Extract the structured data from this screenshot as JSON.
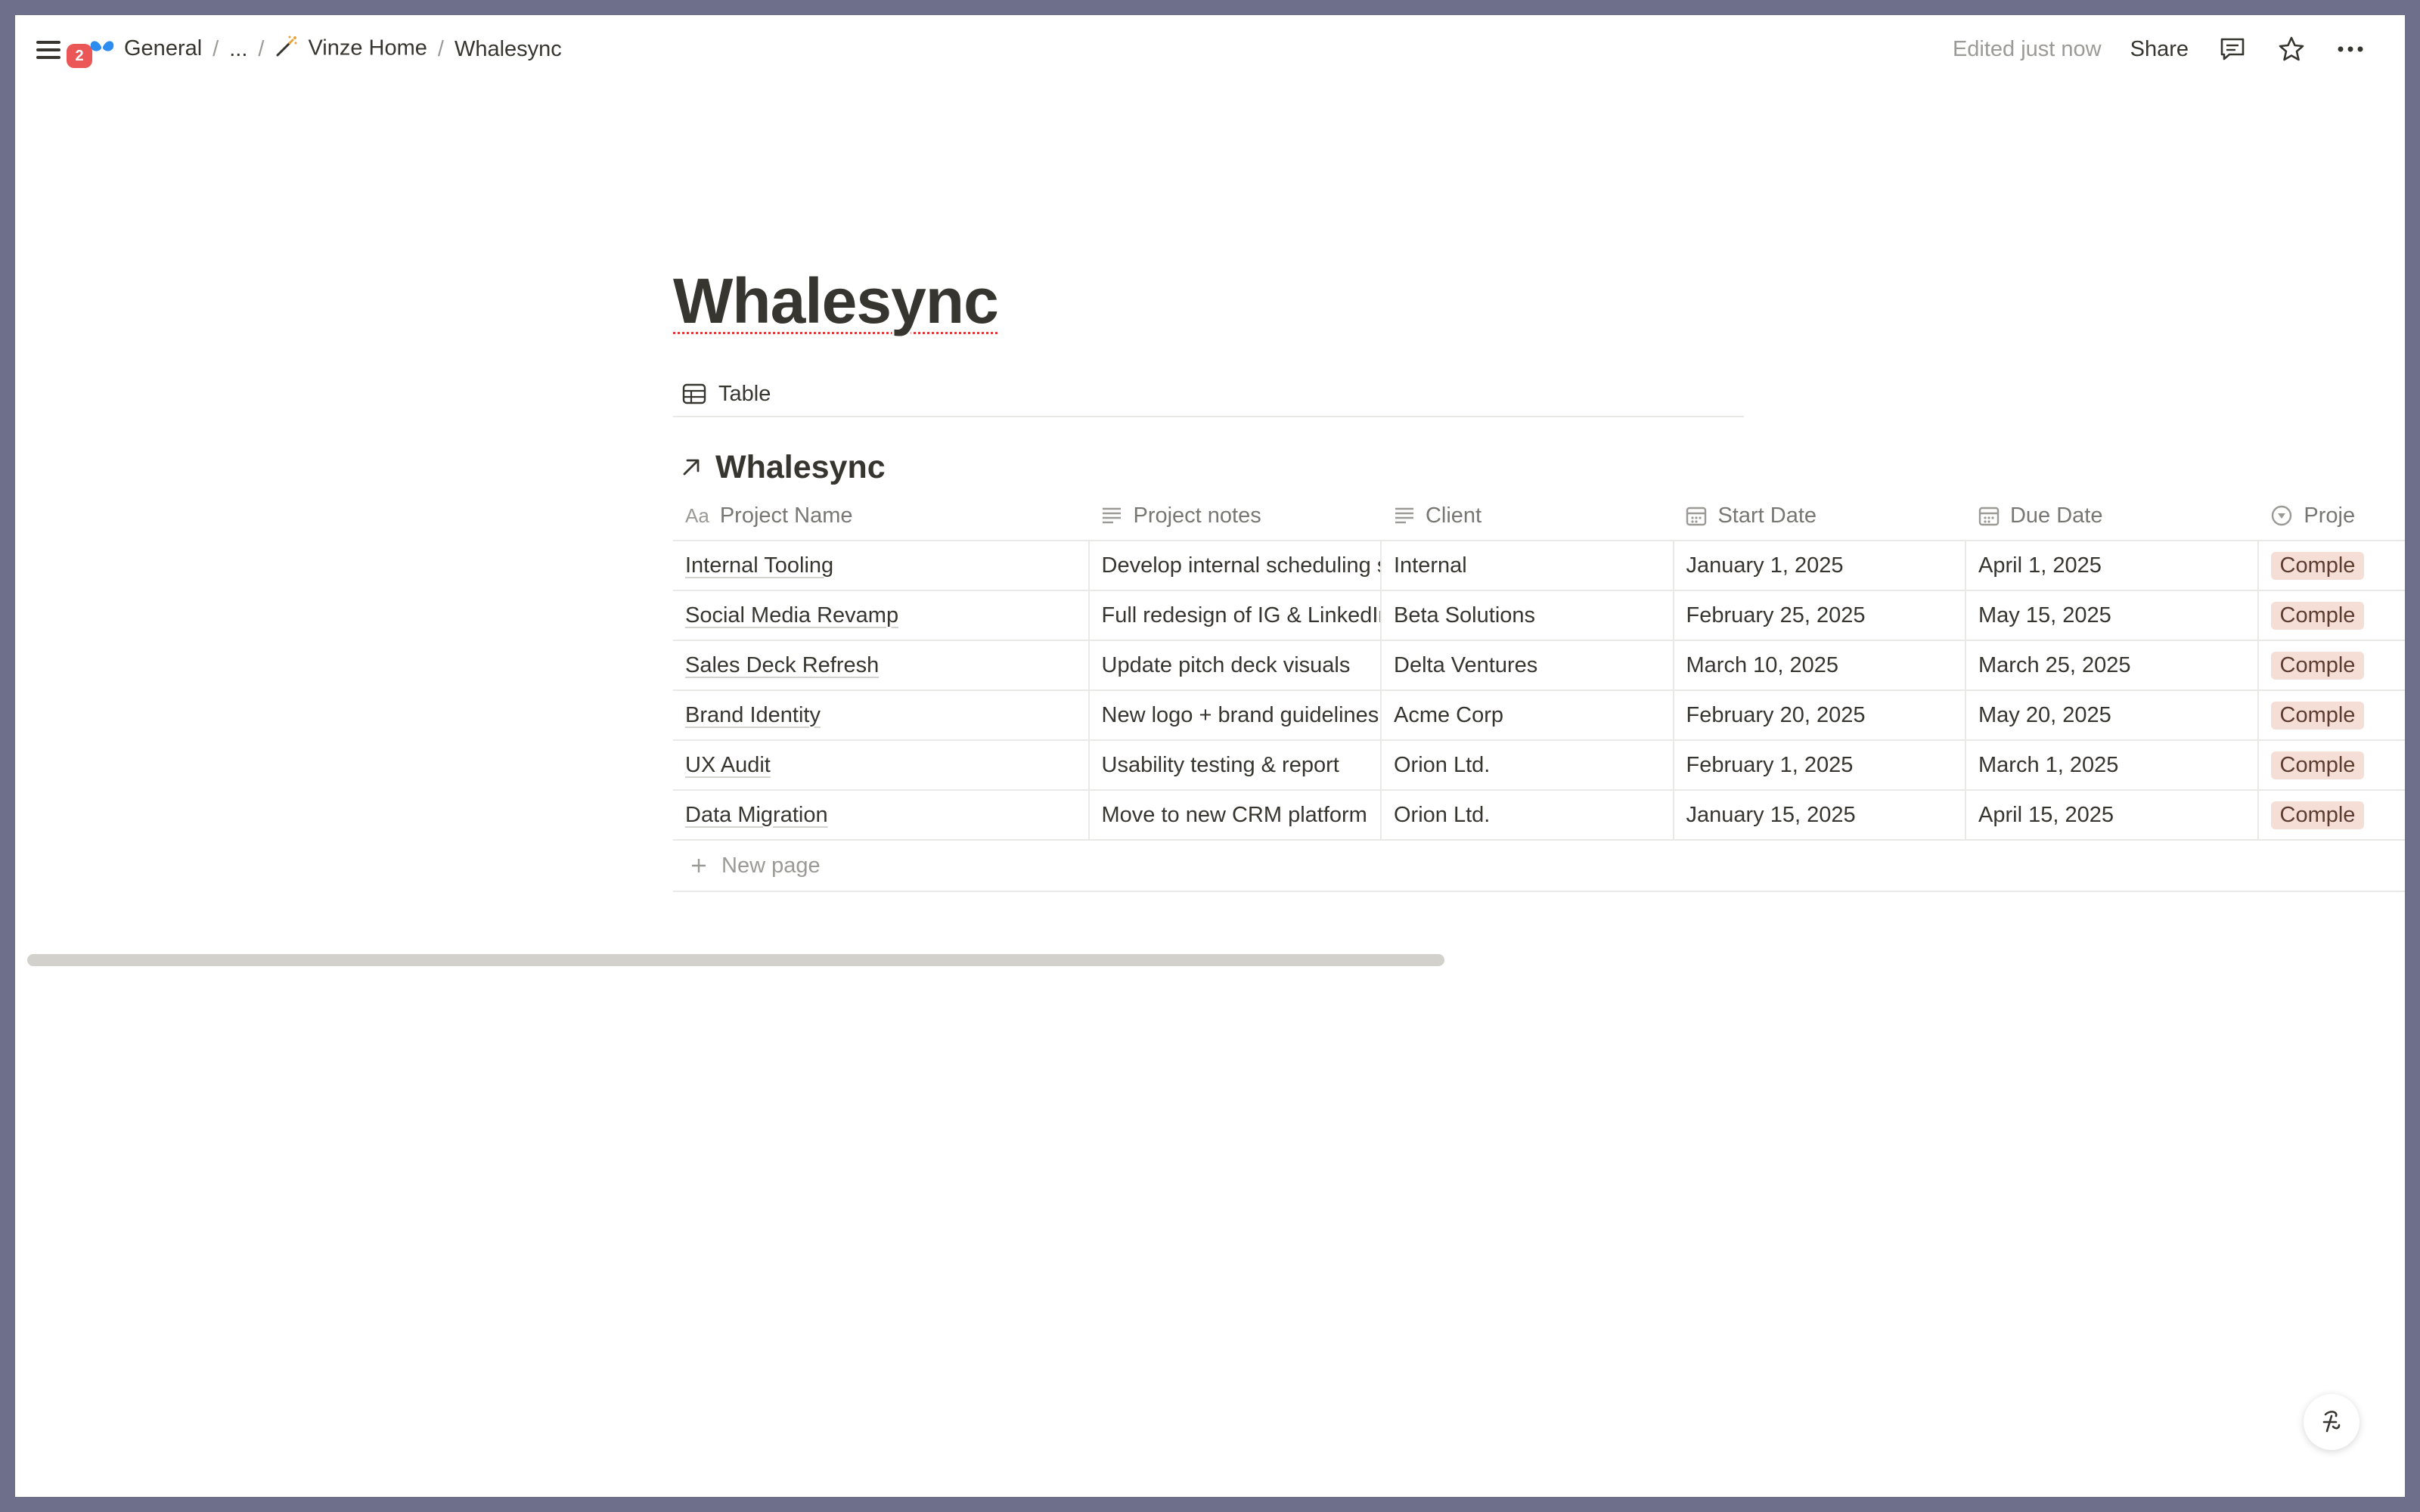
{
  "topbar": {
    "notification_count": "2",
    "breadcrumbs": [
      {
        "label": "General",
        "icon": "butterfly-icon"
      },
      {
        "label": "..."
      },
      {
        "label": "Vinze Home",
        "icon": "magic-wand-icon"
      },
      {
        "label": "Whalesync"
      }
    ],
    "edited_text": "Edited just now",
    "share_label": "Share"
  },
  "page": {
    "title": "Whalesync",
    "view_tab_label": "Table",
    "database_title": "Whalesync"
  },
  "table": {
    "columns": [
      {
        "label": "Project Name",
        "icon": "title-aa-icon"
      },
      {
        "label": "Project notes",
        "icon": "text-lines-icon"
      },
      {
        "label": "Client",
        "icon": "text-lines-icon"
      },
      {
        "label": "Start Date",
        "icon": "calendar-icon"
      },
      {
        "label": "Due Date",
        "icon": "calendar-icon"
      },
      {
        "label": "Proje",
        "icon": "status-icon"
      }
    ],
    "rows": [
      {
        "name": "Internal Tooling",
        "notes": "Develop internal scheduling sy",
        "client": "Internal",
        "start": "January 1, 2025",
        "due": "April 1, 2025",
        "status": "Comple"
      },
      {
        "name": "Social Media Revamp",
        "notes": "Full redesign of IG & LinkedIn",
        "client": "Beta Solutions",
        "start": "February 25, 2025",
        "due": "May 15, 2025",
        "status": "Comple"
      },
      {
        "name": "Sales Deck Refresh",
        "notes": "Update pitch deck visuals",
        "client": "Delta Ventures",
        "start": "March 10, 2025",
        "due": "March 25, 2025",
        "status": "Comple"
      },
      {
        "name": "Brand Identity",
        "notes": "New logo + brand guidelines",
        "client": "Acme Corp",
        "start": "February 20, 2025",
        "due": "May 20, 2025",
        "status": "Comple"
      },
      {
        "name": "UX Audit",
        "notes": "Usability testing & report",
        "client": "Orion Ltd.",
        "start": "February 1, 2025",
        "due": "March 1, 2025",
        "status": "Comple"
      },
      {
        "name": "Data Migration",
        "notes": "Move to new CRM platform",
        "client": "Orion Ltd.",
        "start": "January 15, 2025",
        "due": "April 15, 2025",
        "status": "Comple"
      }
    ],
    "new_page_label": "New page"
  },
  "colors": {
    "status_pill_bg": "#f4ded6",
    "badge": "#eb5757",
    "brand_blue": "#2d8cf0"
  }
}
